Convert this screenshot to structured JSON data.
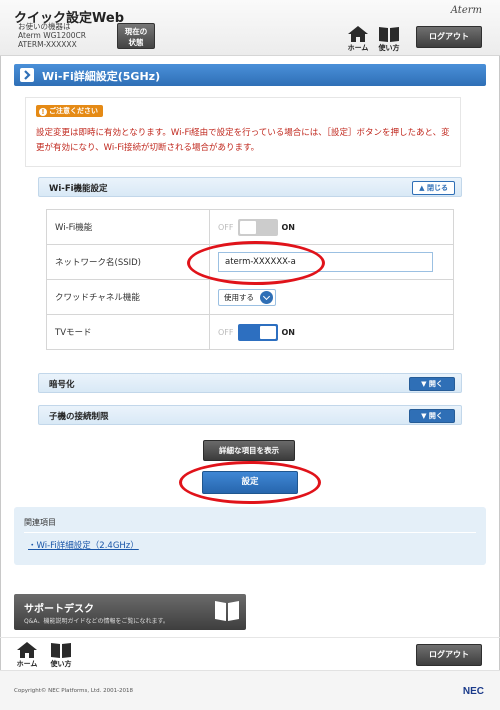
{
  "header": {
    "app_title": "クイック設定Web",
    "device_line1": "お使いの機器は",
    "device_line2": "Aterm WG1200CR",
    "device_line3": "ATERM-XXXXXX",
    "status_button_line1": "現在の",
    "status_button_line2": "状態",
    "brand": "Aterm",
    "home_label": "ホーム",
    "howto_label": "使い方",
    "logout_label": "ログアウト"
  },
  "page": {
    "title": "Wi-Fi詳細設定(5GHz)"
  },
  "notice": {
    "badge": "ご注意ください",
    "text": "設定変更は即時に有効となります。Wi-Fi経由で設定を行っている場合には、［設定］ボタンを押したあと、変更が有効になり、Wi-Fi接続が切断される場合があります。"
  },
  "sections": {
    "wifi_function": {
      "label": "Wi-Fi機能設定",
      "toggle_label": "閉じる"
    },
    "encryption": {
      "label": "暗号化",
      "toggle_label": "開く"
    },
    "client_limit": {
      "label": "子機の接続制限",
      "toggle_label": "開く"
    }
  },
  "settings": {
    "wifi_function": {
      "label": "Wi-Fi機能",
      "off": "OFF",
      "on": "ON",
      "state": "off"
    },
    "ssid": {
      "label": "ネットワーク名(SSID)",
      "value": "aterm-XXXXXX-a"
    },
    "quad_channel": {
      "label": "クワッドチャネル機能",
      "value": "使用する"
    },
    "tv_mode": {
      "label": "TVモード",
      "off": "OFF",
      "on": "ON",
      "state": "on"
    }
  },
  "buttons": {
    "show_details": "詳細な項目を表示",
    "apply": "設定"
  },
  "related": {
    "heading": "関連項目",
    "link": "Wi-Fi詳細設定（2.4GHz）"
  },
  "support": {
    "title": "サポートデスク",
    "subtitle": "Q&A、機能説明ガイドなどの情報をご覧になれます。"
  },
  "footer": {
    "home_label": "ホーム",
    "howto_label": "使い方",
    "logout_label": "ログアウト",
    "copyright": "Copyright© NEC Platforms, Ltd. 2001-2018",
    "logo": "NEC"
  },
  "colors": {
    "accent_blue": "#2f6fb6",
    "notice_red": "#c0281e",
    "badge_orange": "#e58a15",
    "annotation_red": "#e0131a"
  }
}
